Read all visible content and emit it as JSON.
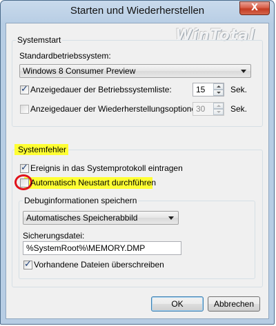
{
  "window": {
    "title": "Starten und Wiederherstellen",
    "close_glyph": "X"
  },
  "watermark": "WinTotal",
  "systemstart": {
    "group_title": "Systemstart",
    "default_os_label": "Standardbetriebssystem:",
    "default_os_value": "Windows 8 Consumer Preview",
    "list_time": {
      "label": "Anzeigedauer der Betriebssystemliste:",
      "checked": true,
      "value": "15",
      "unit": "Sek."
    },
    "recovery_time": {
      "label": "Anzeigedauer der Wiederherstellungsoptionen:",
      "checked": false,
      "value": "30",
      "unit": "Sek.",
      "disabled": true
    }
  },
  "systemfehler": {
    "group_title": "Systemfehler",
    "write_event": {
      "label": "Ereignis in das Systemprotokoll eintragen",
      "checked": true
    },
    "auto_restart": {
      "label": "Automatisch Neustart durchführen",
      "checked": false
    },
    "debug": {
      "group_title": "Debuginformationen speichern",
      "dump_type": "Automatisches Speicherabbild",
      "dump_file_label": "Sicherungsdatei:",
      "dump_file_value": "%SystemRoot%\\MEMORY.DMP",
      "overwrite": {
        "label": "Vorhandene Dateien überschreiben",
        "checked": true
      }
    }
  },
  "buttons": {
    "ok": "OK",
    "cancel": "Abbrechen"
  },
  "colors": {
    "highlight": "#ffff33",
    "annotation_circle": "#e0121b",
    "title_bar": "#b7cde4"
  }
}
